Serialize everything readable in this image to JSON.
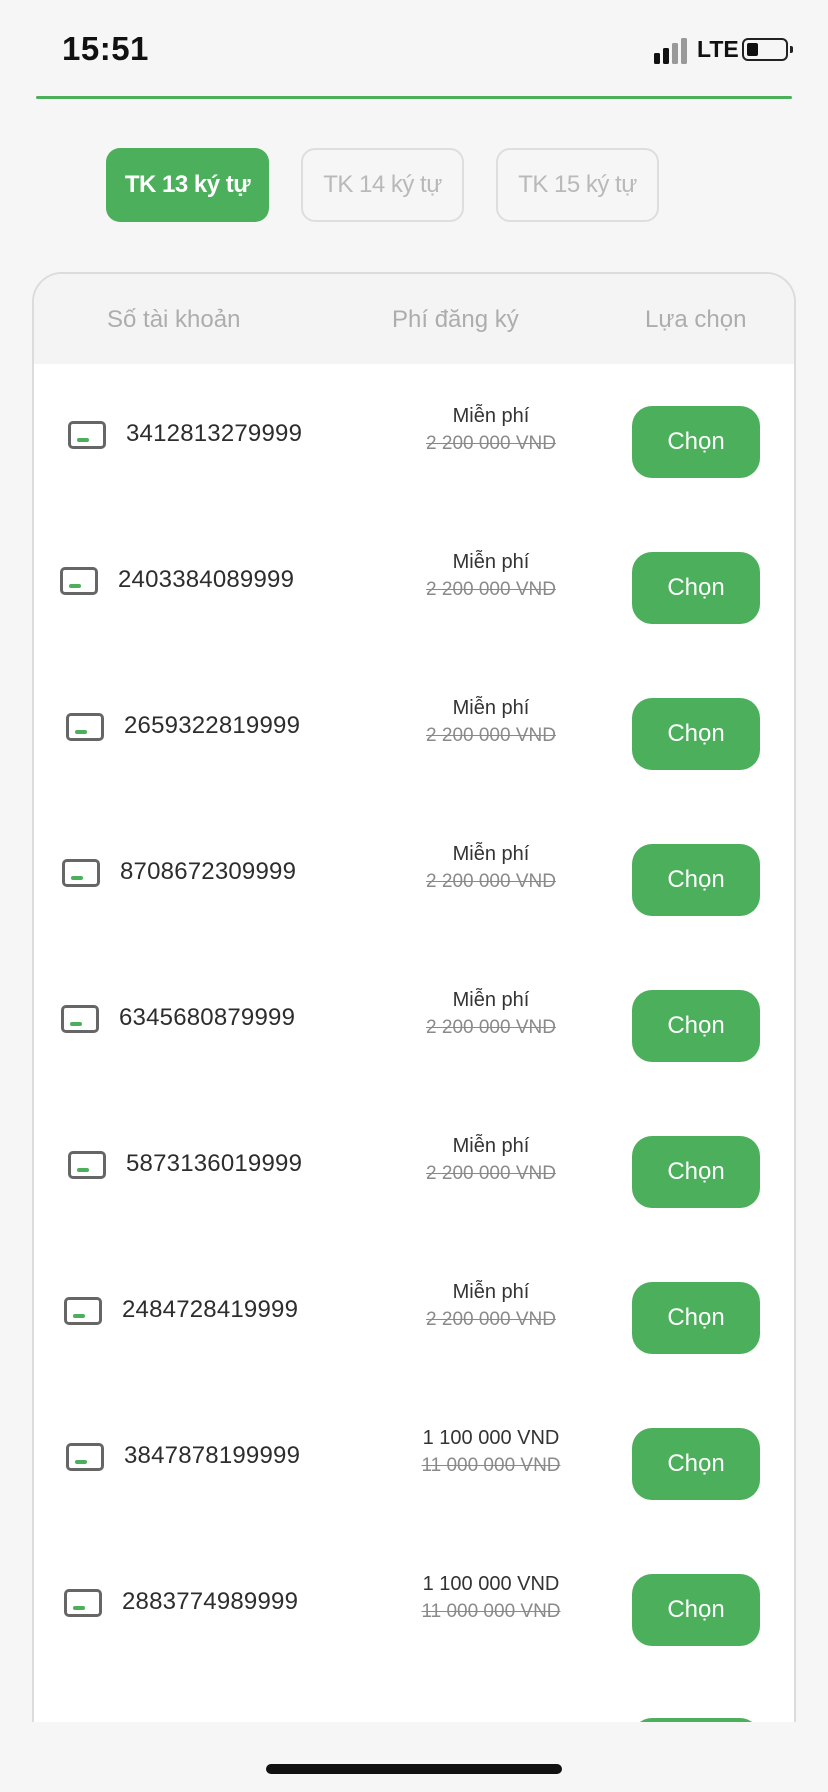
{
  "status_bar": {
    "time": "15:51",
    "network": "LTE"
  },
  "tabs": [
    {
      "label": "TK 13 ký tự",
      "active": true
    },
    {
      "label": "TK 14 ký tự",
      "active": false
    },
    {
      "label": "TK 15 ký tự",
      "active": false
    }
  ],
  "table": {
    "headers": {
      "account": "Số tài khoản",
      "fee": "Phí đăng ký",
      "choice": "Lựa chọn"
    },
    "rows": [
      {
        "account": "3412813279999",
        "fee": "Miễn phí",
        "old_fee": "2 200 000 VND",
        "button": "Chọn"
      },
      {
        "account": "2403384089999",
        "fee": "Miễn phí",
        "old_fee": "2 200 000 VND",
        "button": "Chọn"
      },
      {
        "account": "2659322819999",
        "fee": "Miễn phí",
        "old_fee": "2 200 000 VND",
        "button": "Chọn"
      },
      {
        "account": "8708672309999",
        "fee": "Miễn phí",
        "old_fee": "2 200 000 VND",
        "button": "Chọn"
      },
      {
        "account": "6345680879999",
        "fee": "Miễn phí",
        "old_fee": "2 200 000 VND",
        "button": "Chọn"
      },
      {
        "account": "5873136019999",
        "fee": "Miễn phí",
        "old_fee": "2 200 000 VND",
        "button": "Chọn"
      },
      {
        "account": "2484728419999",
        "fee": "Miễn phí",
        "old_fee": "2 200 000 VND",
        "button": "Chọn"
      },
      {
        "account": "3847878199999",
        "fee": "1 100 000 VND",
        "old_fee": "11 000 000 VND",
        "button": "Chọn"
      },
      {
        "account": "2883774989999",
        "fee": "1 100 000 VND",
        "old_fee": "11 000 000 VND",
        "button": "Chọn"
      }
    ]
  },
  "colors": {
    "accent": "#4caf5c",
    "background": "#f6f6f6",
    "header_bg": "#f4f4f4",
    "muted_text": "#adadad"
  },
  "icons": {
    "account_row": "credit-card-icon"
  }
}
